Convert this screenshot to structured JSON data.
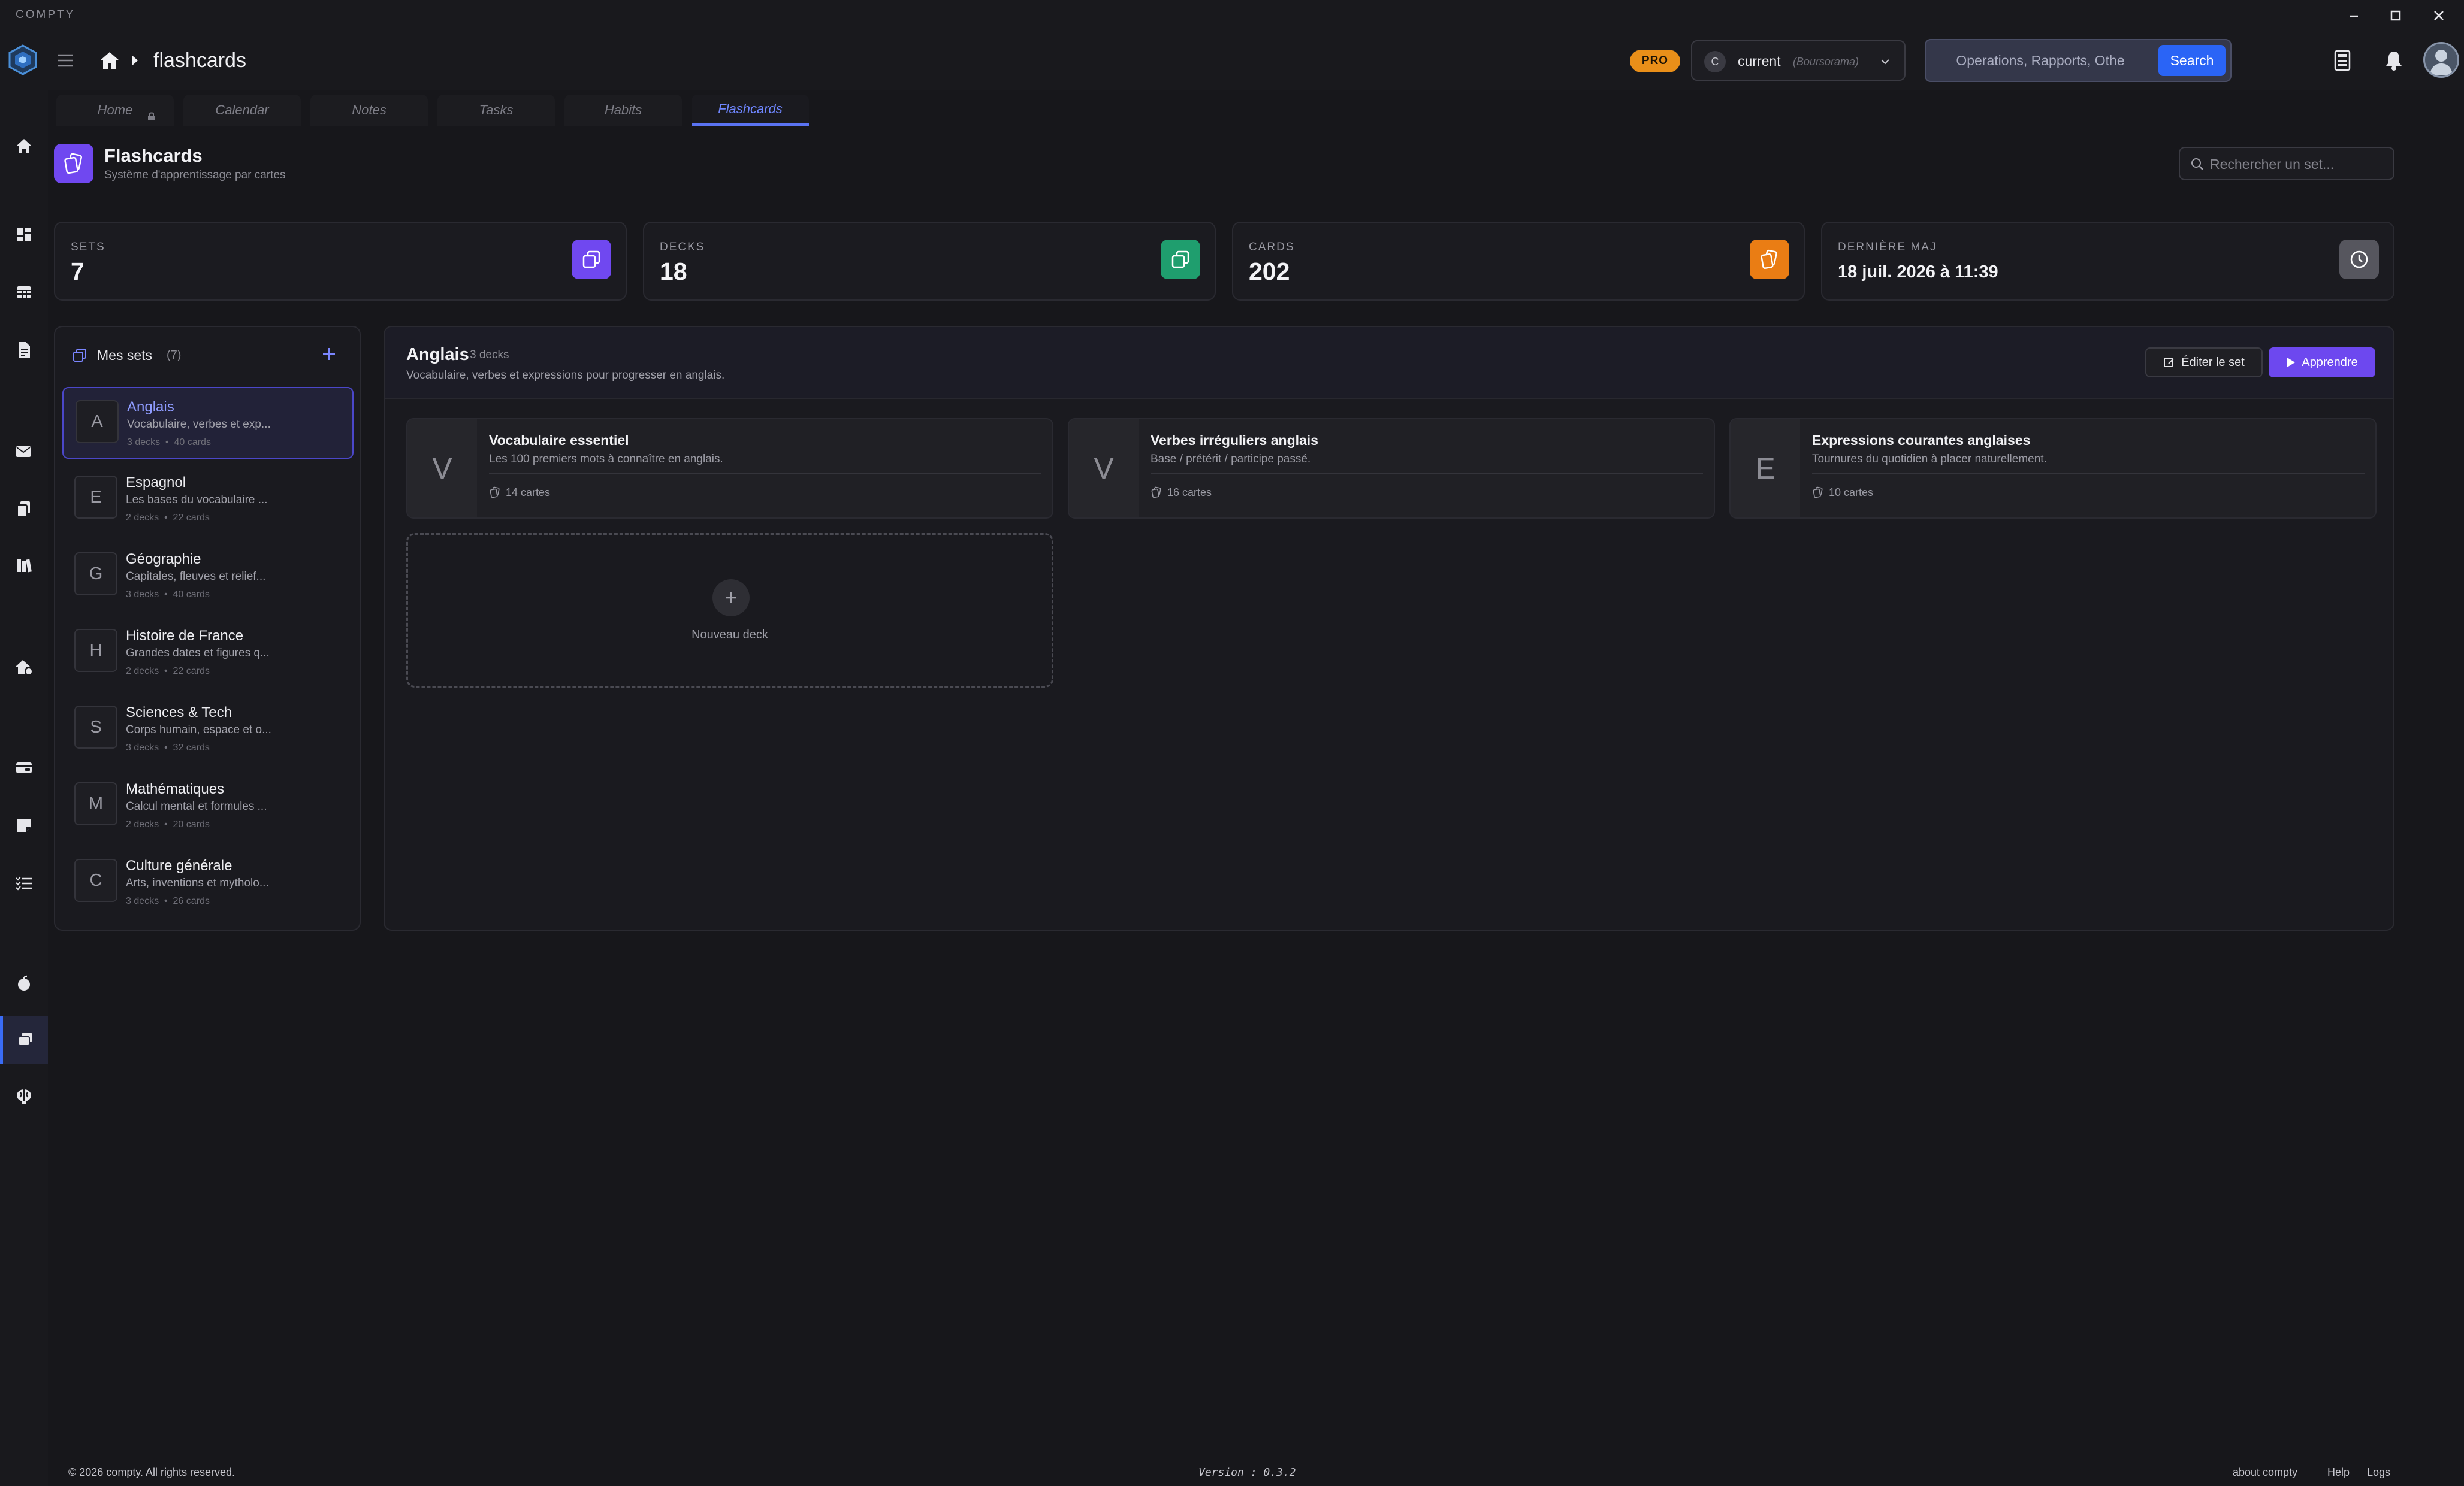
{
  "app": {
    "name": "COMPTY"
  },
  "header": {
    "breadcrumb_title": "flashcards",
    "pro_label": "PRO",
    "account": {
      "initial": "C",
      "name": "current",
      "bank": "(Boursorama)"
    },
    "search": {
      "placeholder": "Operations, Rapports, Othe",
      "button_label": "Search"
    }
  },
  "tabs": [
    {
      "label": "Home"
    },
    {
      "label": "Calendar"
    },
    {
      "label": "Notes"
    },
    {
      "label": "Tasks"
    },
    {
      "label": "Habits"
    },
    {
      "label": "Flashcards",
      "active": true
    }
  ],
  "page": {
    "title": "Flashcards",
    "subtitle": "Système d'apprentissage par cartes",
    "search_placeholder": "Rechercher un set..."
  },
  "stats": [
    {
      "label": "SETS",
      "value": "7",
      "color": "#7048f0"
    },
    {
      "label": "DECKS",
      "value": "18",
      "color": "#1f9e6e"
    },
    {
      "label": "CARDS",
      "value": "202",
      "color": "#ea7d14"
    },
    {
      "label": "DERNIÈRE MAJ",
      "value": "18 juil. 2026 à 11:39",
      "color": "#56565e"
    }
  ],
  "sidebar": {
    "title": "Mes sets",
    "count": "(7)",
    "sets": [
      {
        "letter": "A",
        "name": "Anglais",
        "desc": "Vocabulaire, verbes et exp...",
        "decks": "3 decks",
        "cards": "40 cards",
        "active": true
      },
      {
        "letter": "E",
        "name": "Espagnol",
        "desc": "Les bases du vocabulaire ...",
        "decks": "2 decks",
        "cards": "22 cards"
      },
      {
        "letter": "G",
        "name": "Géographie",
        "desc": "Capitales, fleuves et relief...",
        "decks": "3 decks",
        "cards": "40 cards"
      },
      {
        "letter": "H",
        "name": "Histoire de France",
        "desc": "Grandes dates et figures q...",
        "decks": "2 decks",
        "cards": "22 cards"
      },
      {
        "letter": "S",
        "name": "Sciences & Tech",
        "desc": "Corps humain, espace et o...",
        "decks": "3 decks",
        "cards": "32 cards"
      },
      {
        "letter": "M",
        "name": "Mathématiques",
        "desc": "Calcul mental et formules ...",
        "decks": "2 decks",
        "cards": "20 cards"
      },
      {
        "letter": "C",
        "name": "Culture générale",
        "desc": "Arts, inventions et mytholo...",
        "decks": "3 decks",
        "cards": "26 cards"
      }
    ]
  },
  "main": {
    "title": "Anglais",
    "deck_count": "3 decks",
    "description": "Vocabulaire, verbes et expressions pour progresser en anglais.",
    "edit_label": "Éditer le set",
    "learn_label": "Apprendre",
    "decks": [
      {
        "letter": "V",
        "name": "Vocabulaire essentiel",
        "desc": "Les 100 premiers mots à connaître en anglais.",
        "cards": "14 cartes"
      },
      {
        "letter": "V",
        "name": "Verbes irréguliers anglais",
        "desc": "Base / prétérit / participe passé.",
        "cards": "16 cartes"
      },
      {
        "letter": "E",
        "name": "Expressions courantes anglaises",
        "desc": "Tournures du quotidien à placer naturellement.",
        "cards": "10 cartes"
      }
    ],
    "new_deck_label": "Nouveau deck"
  },
  "footer": {
    "copyright": "© 2026 compty. All rights reserved.",
    "version": "Version : 0.3.2",
    "links": [
      "about compty",
      "Help",
      "Logs"
    ]
  },
  "colors": {
    "accent": "#6d48ef",
    "link": "#2a64f6",
    "pro": "#e98f19"
  }
}
